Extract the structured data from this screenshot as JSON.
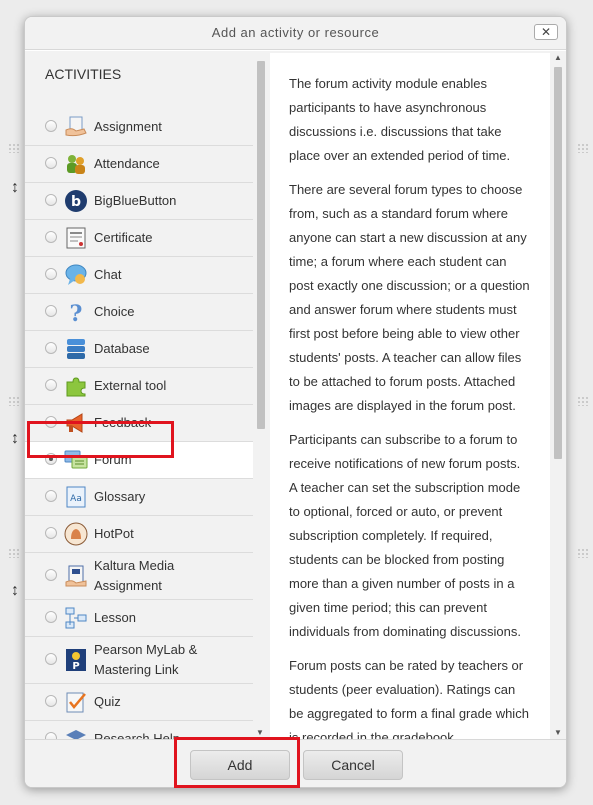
{
  "dialog": {
    "title": "Add an activity or resource",
    "close_label": "✕"
  },
  "activities": {
    "heading": "ACTIVITIES",
    "items": [
      {
        "label": "Assignment",
        "icon": "assignment-icon",
        "selected": false
      },
      {
        "label": "Attendance",
        "icon": "attendance-icon",
        "selected": false
      },
      {
        "label": "BigBlueButton",
        "icon": "bigbluebutton-icon",
        "selected": false
      },
      {
        "label": "Certificate",
        "icon": "certificate-icon",
        "selected": false
      },
      {
        "label": "Chat",
        "icon": "chat-icon",
        "selected": false
      },
      {
        "label": "Choice",
        "icon": "choice-icon",
        "selected": false
      },
      {
        "label": "Database",
        "icon": "database-icon",
        "selected": false
      },
      {
        "label": "External tool",
        "icon": "external-tool-icon",
        "selected": false
      },
      {
        "label": "Feedback",
        "icon": "feedback-icon",
        "selected": false
      },
      {
        "label": "Forum",
        "icon": "forum-icon",
        "selected": true
      },
      {
        "label": "Glossary",
        "icon": "glossary-icon",
        "selected": false
      },
      {
        "label": "HotPot",
        "icon": "hotpot-icon",
        "selected": false
      },
      {
        "label": "Kaltura Media Assignment",
        "icon": "kaltura-media-assignment-icon",
        "selected": false
      },
      {
        "label": "Lesson",
        "icon": "lesson-icon",
        "selected": false
      },
      {
        "label": "Pearson MyLab & Mastering Link",
        "icon": "pearson-mylab-icon",
        "selected": false
      },
      {
        "label": "Quiz",
        "icon": "quiz-icon",
        "selected": false
      },
      {
        "label": "Research Help",
        "icon": "research-help-icon",
        "selected": false
      }
    ]
  },
  "help": {
    "paragraphs": [
      "The forum activity module enables participants to have asynchronous discussions i.e. discussions that take place over an extended period of time.",
      "There are several forum types to choose from, such as a standard forum where anyone can start a new discussion at any time; a forum where each student can post exactly one discussion; or a question and answer forum where students must first post before being able to view other students' posts. A teacher can allow files to be attached to forum posts. Attached images are displayed in the forum post.",
      "Participants can subscribe to a forum to receive notifications of new forum posts. A teacher can set the subscription mode to optional, forced or auto, or prevent subscription completely. If required, students can be blocked from posting more than a given number of posts in a given time period; this can prevent individuals from dominating discussions.",
      "Forum posts can be rated by teachers or students (peer evaluation). Ratings can be aggregated to form a final grade which is recorded in the gradebook."
    ]
  },
  "footer": {
    "add_label": "Add",
    "cancel_label": "Cancel"
  },
  "colors": {
    "highlight": "#e0141e"
  }
}
